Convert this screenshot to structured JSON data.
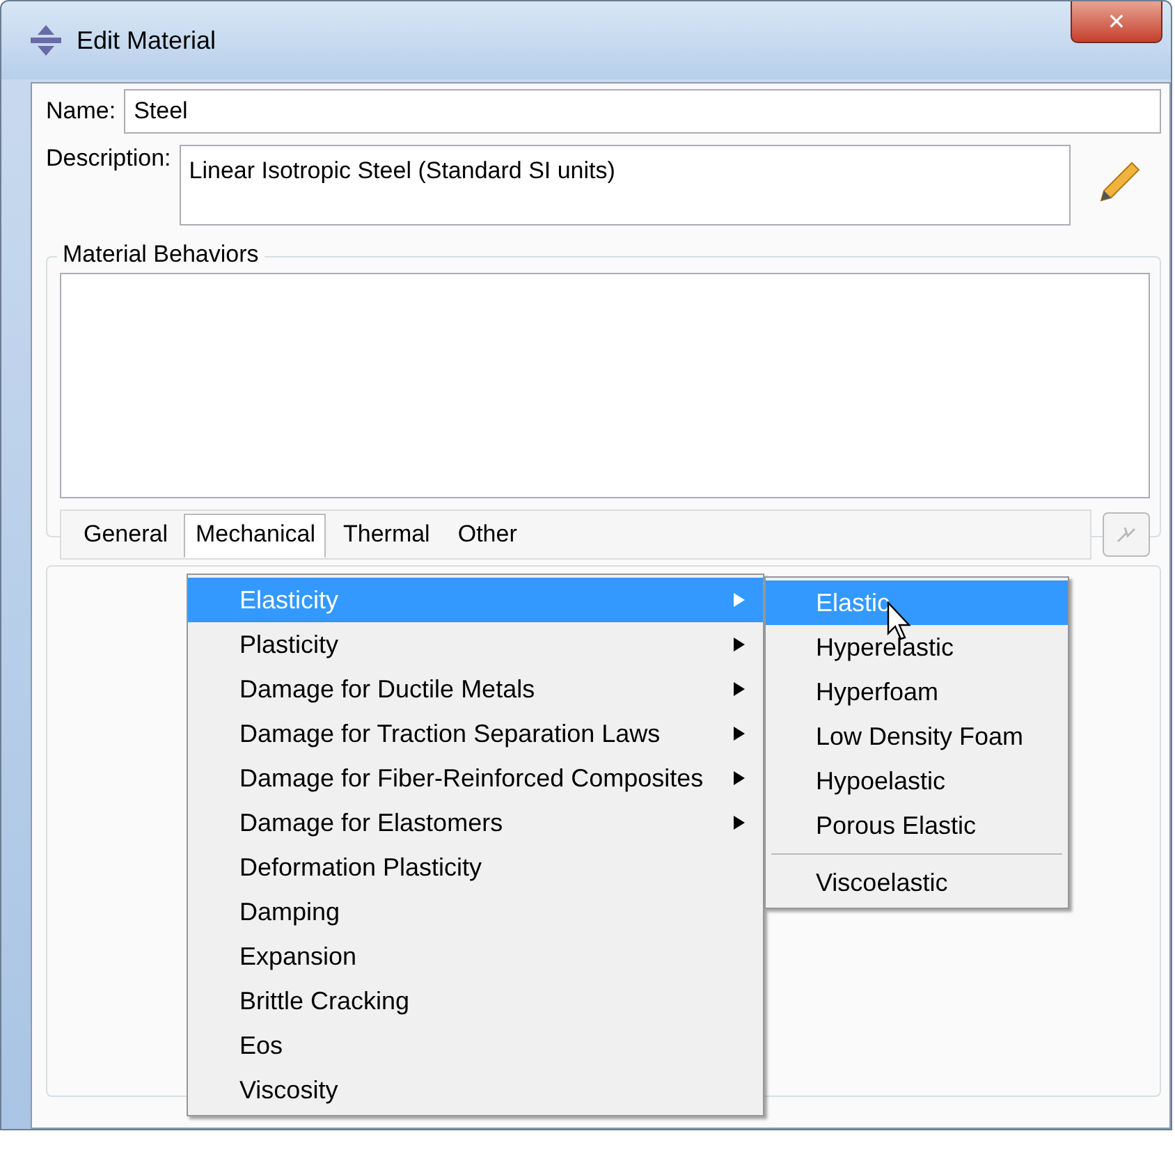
{
  "window": {
    "title": "Edit Material",
    "close": "✕"
  },
  "name": {
    "label": "Name:",
    "value": "Steel"
  },
  "description": {
    "label": "Description:",
    "value": "Linear Isotropic Steel (Standard SI units)"
  },
  "material_behaviors": {
    "title": "Material Behaviors"
  },
  "tabs": [
    {
      "label": "General",
      "selected": false
    },
    {
      "label": "Mechanical",
      "selected": true
    },
    {
      "label": "Thermal",
      "selected": false
    },
    {
      "label": "Other",
      "selected": false
    }
  ],
  "menu": {
    "items": [
      {
        "label": "Elasticity",
        "has_submenu": true,
        "selected": true
      },
      {
        "label": "Plasticity",
        "has_submenu": true,
        "selected": false
      },
      {
        "label": "Damage for Ductile Metals",
        "has_submenu": true,
        "selected": false
      },
      {
        "label": "Damage for Traction Separation Laws",
        "has_submenu": true,
        "selected": false
      },
      {
        "label": "Damage for Fiber-Reinforced Composites",
        "has_submenu": true,
        "selected": false
      },
      {
        "label": "Damage for Elastomers",
        "has_submenu": true,
        "selected": false
      },
      {
        "label": "Deformation Plasticity",
        "has_submenu": false,
        "selected": false
      },
      {
        "label": "Damping",
        "has_submenu": false,
        "selected": false
      },
      {
        "label": "Expansion",
        "has_submenu": false,
        "selected": false
      },
      {
        "label": "Brittle Cracking",
        "has_submenu": false,
        "selected": false
      },
      {
        "label": "Eos",
        "has_submenu": false,
        "selected": false
      },
      {
        "label": "Viscosity",
        "has_submenu": false,
        "selected": false
      }
    ]
  },
  "submenu": {
    "items": [
      {
        "kind": "item",
        "label": "Elastic",
        "selected": true
      },
      {
        "kind": "item",
        "label": "Hyperelastic",
        "selected": false
      },
      {
        "kind": "item",
        "label": "Hyperfoam",
        "selected": false
      },
      {
        "kind": "item",
        "label": "Low Density Foam",
        "selected": false
      },
      {
        "kind": "item",
        "label": "Hypoelastic",
        "selected": false
      },
      {
        "kind": "item",
        "label": "Porous Elastic",
        "selected": false
      },
      {
        "kind": "separator"
      },
      {
        "kind": "item",
        "label": "Viscoelastic",
        "selected": false
      }
    ]
  }
}
